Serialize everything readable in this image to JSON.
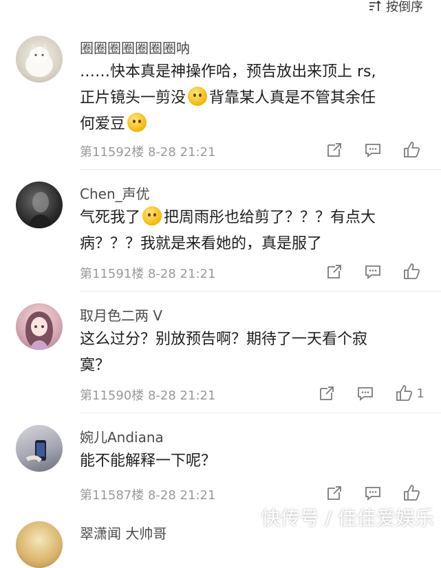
{
  "header": {
    "sort_label": "按倒序",
    "sort_icon": "sort-order-icon"
  },
  "comments": [
    {
      "username": "圈圈圈圈圈圈圈呐",
      "line1": "……快本真是神操作哈，预告放出来顶上 rs,",
      "line2a": "正片镜头一剪没",
      "line2b": "背靠某人真是不管其余任",
      "line3": "何爱豆",
      "meta": "第11592楼 8-28 21:21",
      "likes": ""
    },
    {
      "username": "Chen_声优",
      "line1a": "气死我了",
      "line1b": "把周雨彤也给剪了？？？有点大",
      "line2": "病？？？我就是来看她的，真是服了",
      "meta": "第11591楼 8-28 21:21",
      "likes": ""
    },
    {
      "username": "取月色二两 V",
      "line1": "这么过分？别放预告啊？期待了一天看个寂",
      "line2": "寞？",
      "meta": "第11590楼 8-28 21:21",
      "likes": "1"
    },
    {
      "username": "婉儿Andiana",
      "line1": "能不能解释一下呢？",
      "meta": "第11587楼 8-28 21:21",
      "likes": ""
    },
    {
      "username": "翠潇闻",
      "extra": "大帅哥"
    }
  ],
  "watermark": "快传号 / 佳佳爱娱乐"
}
